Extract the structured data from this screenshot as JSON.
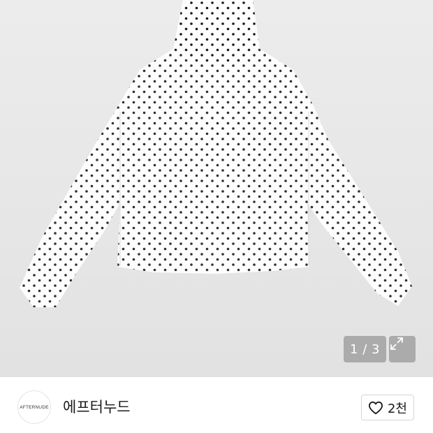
{
  "product": {
    "image_alt": "polka dot hooded long-sleeve top",
    "pager": "1 / 3"
  },
  "icons": {
    "expand": "expand-icon",
    "heart": "heart-icon"
  },
  "store": {
    "logo_text": "AFTERNUDE",
    "name": "에프터누드",
    "likes": "2천"
  },
  "colors": {
    "image_background": "#e6e6e6",
    "pager_background": "#969696",
    "dots": "#1a1a1a"
  }
}
